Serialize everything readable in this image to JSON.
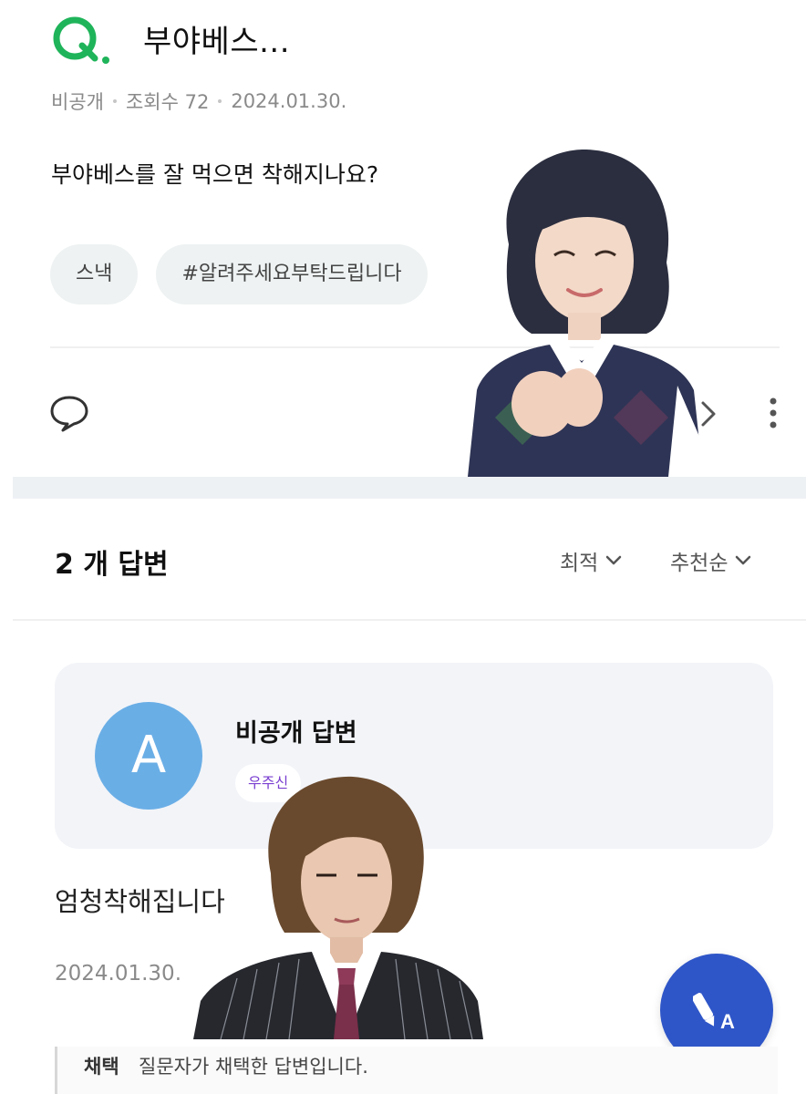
{
  "question": {
    "mark": "Q.",
    "title": "부야베스...",
    "author": "비공개",
    "views_label": "조회수 72",
    "date": "2024.01.30.",
    "body": "부야베스를 잘 먹으면 착해지나요?",
    "tags": [
      "스낵",
      "#알려주세요부탁드립니다"
    ]
  },
  "answers_header": {
    "count_label": "2 개 답변",
    "sort_best": "최적",
    "sort_recommend": "추천순"
  },
  "answer": {
    "avatar_letter": "A",
    "author": "비공개 답변",
    "level_badge": "우주신",
    "body": "엄청착해집니다",
    "date": "2024.01.30.",
    "chosen_label": "채택",
    "chosen_text": "질문자가 채택한 답변입니다."
  },
  "colors": {
    "brand_green": "#1fb45a",
    "avatar_blue": "#6aaee6",
    "fab_blue": "#2f56c8",
    "badge_purple": "#7a3fd0"
  },
  "icons": [
    "q-logo-icon",
    "comment-icon",
    "chevron-right-icon",
    "more-vertical-icon",
    "chevron-down-icon",
    "write-answer-icon"
  ]
}
